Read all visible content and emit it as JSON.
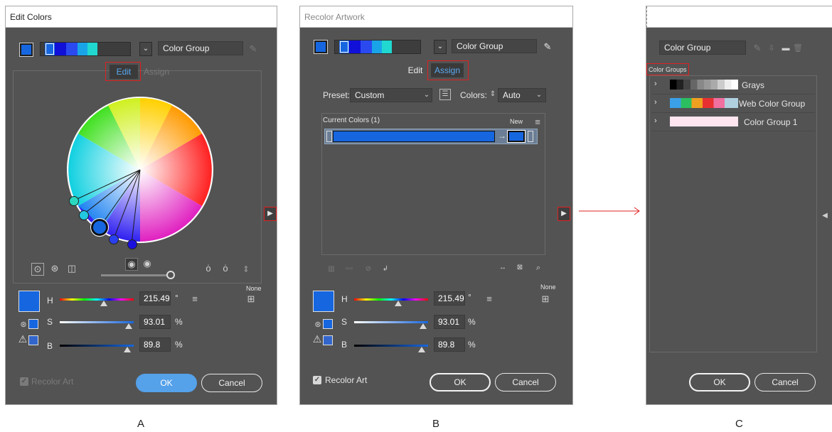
{
  "colors": {
    "accent_blue": "#1666e0",
    "highlight_red": "#e02020",
    "dialog_bg": "#535353"
  },
  "panel_a": {
    "title": "Edit Colors",
    "group_name": "Color Group",
    "tab_edit": "Edit",
    "tab_assign": "Assign",
    "h_label": "H",
    "h_value": "215.49",
    "h_unit": "°",
    "s_label": "S",
    "s_value": "93.01",
    "s_unit": "%",
    "b_label": "B",
    "b_value": "89.8",
    "b_unit": "%",
    "none_label": "None",
    "recolor_label": "Recolor Art",
    "ok_label": "OK",
    "cancel_label": "Cancel",
    "caption": "A"
  },
  "panel_b": {
    "title": "Recolor Artwork",
    "group_name": "Color Group",
    "tab_edit": "Edit",
    "tab_assign": "Assign",
    "preset_label": "Preset:",
    "preset_value": "Custom",
    "colors_label": "Colors:",
    "colors_value": "Auto",
    "current_colors_label": "Current Colors (1)",
    "new_label": "New",
    "h_label": "H",
    "h_value": "215.49",
    "h_unit": "°",
    "s_label": "S",
    "s_value": "93.01",
    "s_unit": "%",
    "b_label": "B",
    "b_value": "89.8",
    "b_unit": "%",
    "none_label": "None",
    "recolor_label": "Recolor Art",
    "ok_label": "OK",
    "cancel_label": "Cancel",
    "caption": "B"
  },
  "panel_c": {
    "group_name": "Color Group",
    "color_groups_label": "Color Groups",
    "groups": [
      {
        "name": "Grays"
      },
      {
        "name": "Web Color Group"
      },
      {
        "name": "Color Group 1"
      }
    ],
    "ok_label": "OK",
    "cancel_label": "Cancel",
    "caption": "C"
  }
}
